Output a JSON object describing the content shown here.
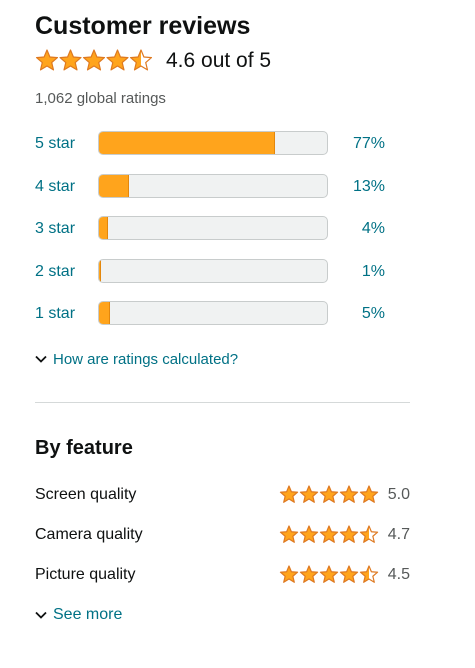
{
  "header": {
    "title": "Customer reviews",
    "rating": 4.6,
    "rating_text": "4.6 out of 5",
    "global_ratings": "1,062 global ratings"
  },
  "histogram": [
    {
      "label": "5 star",
      "percent_text": "77%",
      "percent": 77
    },
    {
      "label": "4 star",
      "percent_text": "13%",
      "percent": 13
    },
    {
      "label": "3 star",
      "percent_text": "4%",
      "percent": 4
    },
    {
      "label": "2 star",
      "percent_text": "1%",
      "percent": 1
    },
    {
      "label": "1 star",
      "percent_text": "5%",
      "percent": 5
    }
  ],
  "calc_link": "How are ratings calculated?",
  "features": {
    "title": "By feature",
    "items": [
      {
        "name": "Screen quality",
        "score_text": "5.0",
        "stars": 5.0
      },
      {
        "name": "Camera quality",
        "score_text": "4.7",
        "stars": 4.7
      },
      {
        "name": "Picture quality",
        "score_text": "4.5",
        "stars": 4.5
      }
    ]
  },
  "see_more": "See more",
  "icons": {
    "star": "star-icon",
    "half_star": "half-star-icon",
    "chevron": "chevron-down-icon"
  },
  "colors": {
    "star": "#ffa41c",
    "star_stroke": "#de7921",
    "link": "#007185",
    "bar_fill": "#ffa41c",
    "bar_track": "#f0f2f2"
  }
}
